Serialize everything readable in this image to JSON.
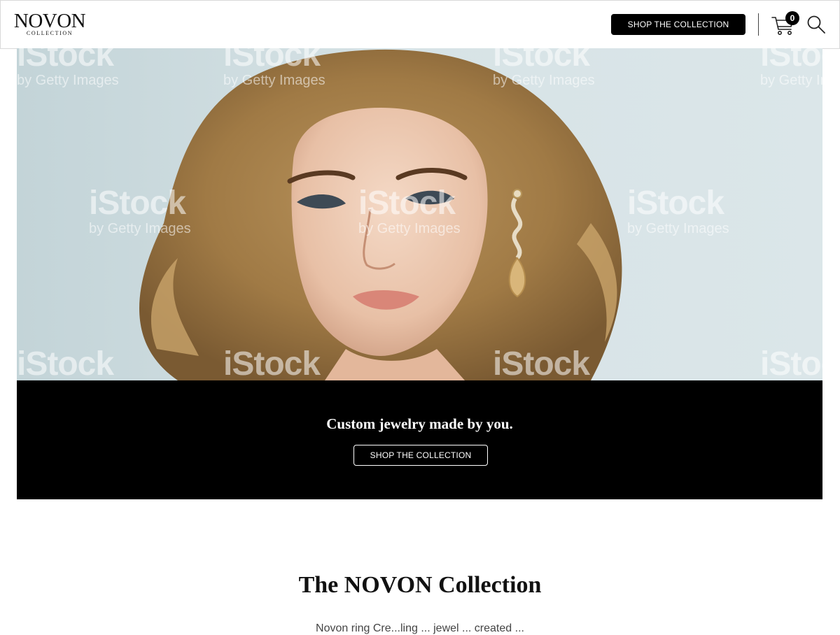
{
  "header": {
    "logo_main": "NOVON",
    "logo_sub": "COLLECTION",
    "shop_button_label": "SHOP THE COLLECTION",
    "cart_count": "0",
    "cart_icon": "cart-icon",
    "search_icon": "search-icon"
  },
  "hero": {
    "watermark_main": "iStock",
    "watermark_sub": "by Getty Images"
  },
  "banner": {
    "tagline": "Custom jewelry made by you.",
    "button_label": "SHOP THE COLLECTION"
  },
  "section": {
    "title": "The NOVON Collection",
    "partial_text": "Novon ring Cre...ling ... jewel ... created ..."
  },
  "colors": {
    "header_button_bg": "#000000",
    "banner_bg": "#000000",
    "hero_background": "#d3e0e3"
  }
}
